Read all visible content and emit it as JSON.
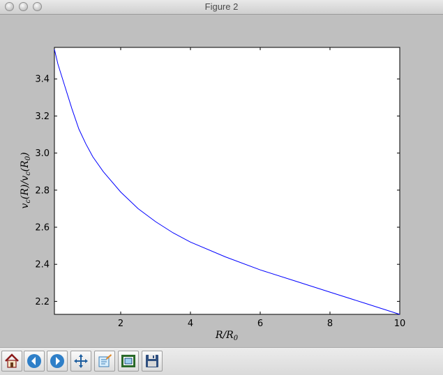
{
  "window": {
    "title": "Figure 2"
  },
  "toolbar": {
    "buttons": [
      {
        "icon": "home-icon"
      },
      {
        "icon": "back-arrow-icon"
      },
      {
        "icon": "forward-arrow-icon"
      },
      {
        "icon": "pan-arrows-icon"
      },
      {
        "icon": "zoom-to-rect-icon"
      },
      {
        "icon": "configure-subplots-icon"
      },
      {
        "icon": "save-floppy-icon"
      }
    ]
  },
  "chart_data": {
    "type": "line",
    "title": "",
    "xlabel": "R/R0",
    "ylabel": "v_c(R)/v_c(R0)",
    "xlim": [
      0.1,
      10
    ],
    "ylim": [
      2.13,
      3.57
    ],
    "xticks": [
      2,
      4,
      6,
      8,
      10
    ],
    "yticks": [
      2.2,
      2.4,
      2.6,
      2.8,
      3.0,
      3.2,
      3.4
    ],
    "ytick_labels": [
      "2.2",
      "2.4",
      "2.6",
      "2.8",
      "3.0",
      "3.2",
      "3.4"
    ],
    "grid": false,
    "line_color": "#0000ff",
    "series": [
      {
        "x": [
          0.1,
          0.2,
          0.3,
          0.4,
          0.5,
          0.6,
          0.8,
          1.0,
          1.2,
          1.5,
          2.0,
          2.5,
          3.0,
          3.5,
          4.0,
          5.0,
          6.0,
          7.0,
          8.0,
          9.0,
          10.0
        ],
        "y": [
          3.56,
          3.48,
          3.42,
          3.36,
          3.3,
          3.24,
          3.13,
          3.05,
          2.98,
          2.9,
          2.79,
          2.7,
          2.63,
          2.57,
          2.52,
          2.44,
          2.37,
          2.31,
          2.25,
          2.19,
          2.13
        ]
      }
    ]
  }
}
